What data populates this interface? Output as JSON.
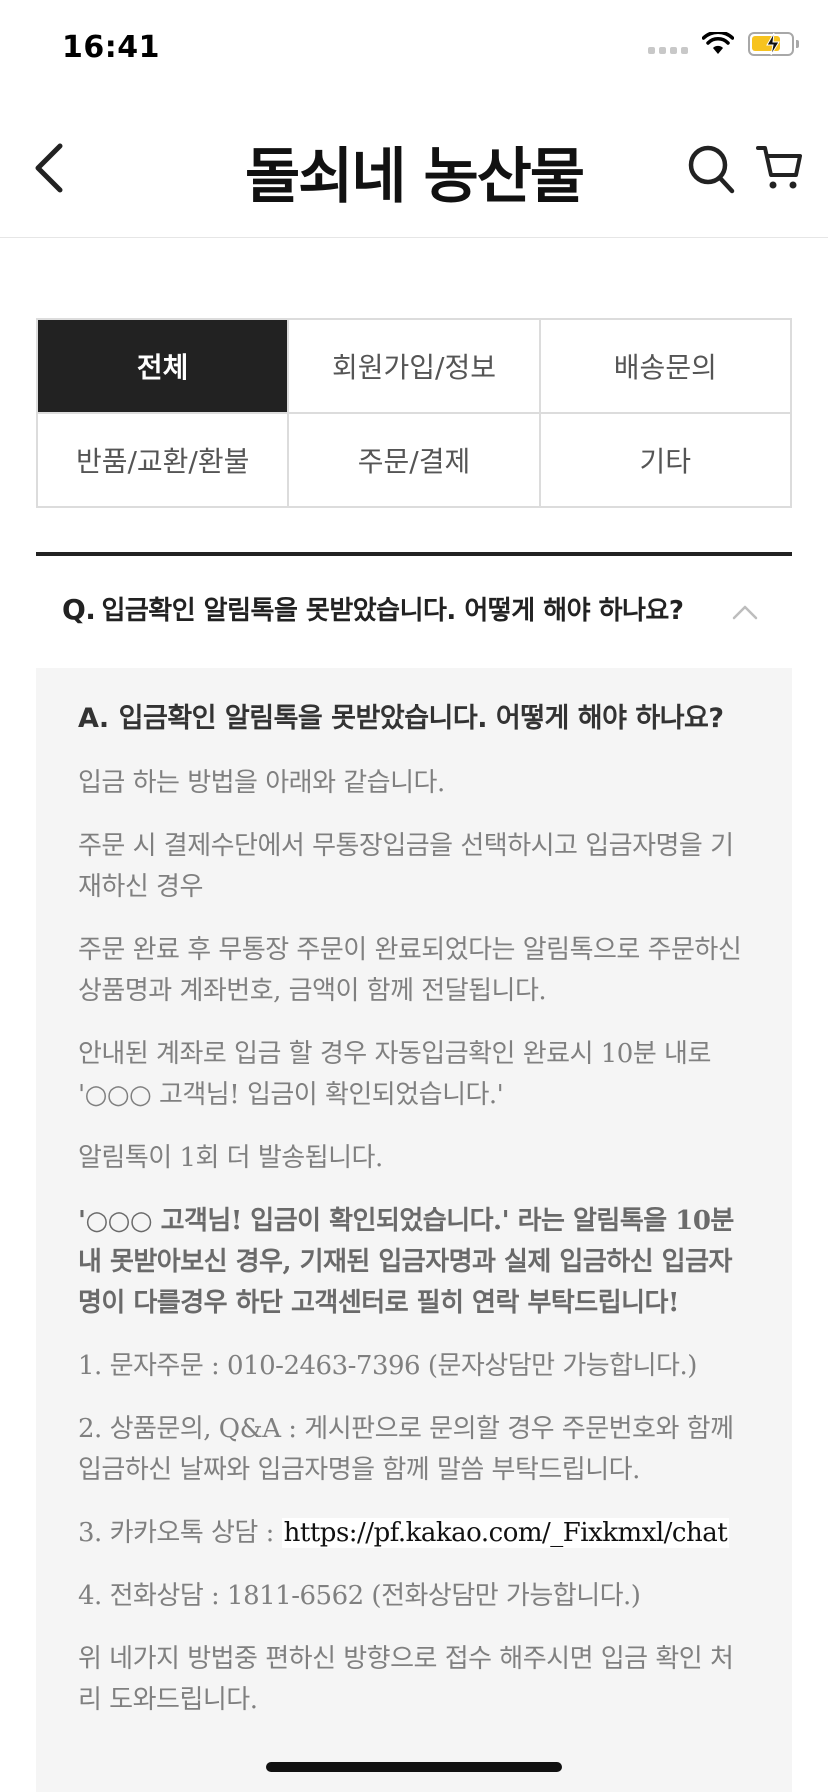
{
  "status_bar": {
    "time": "16:41"
  },
  "nav": {
    "title": "돌쇠네 농산물"
  },
  "categories": [
    {
      "label": "전체",
      "active": true
    },
    {
      "label": "회원가입/정보",
      "active": false
    },
    {
      "label": "배송문의",
      "active": false
    },
    {
      "label": "반품/교환/환불",
      "active": false
    },
    {
      "label": "주문/결제",
      "active": false
    },
    {
      "label": "기타",
      "active": false
    }
  ],
  "faq": {
    "question_prefix": "Q.",
    "question": "입금확인 알림톡을 못받았습니다. 어떻게 해야 하나요?",
    "answer_prefix": "A.",
    "answer_title": "입금확인 알림톡을 못받았습니다. 어떻게 해야 하나요?",
    "paragraphs": [
      "입금 하는 방법을 아래와 같습니다.",
      "주문 시 결제수단에서 무통장입금을 선택하시고 입금자명을 기재하신 경우",
      "주문 완료 후 무통장 주문이 완료되었다는 알림톡으로  주문하신 상품명과 계좌번호, 금액이 함께 전달됩니다.",
      "안내된 계좌로 입금 할 경우 자동입금확인 완료시 10분 내로 '○○○ 고객님! 입금이 확인되었습니다.'",
      "알림톡이 1회 더 발송됩니다.",
      " '○○○ 고객님! 입금이 확인되었습니다.' 라는 알림톡을 10분 내 못받아보신 경우, 기재된 입금자명과 실제 입금하신 입금자명이 다를경우 하단 고객센터로 필히 연락 부탁드립니다!",
      " 1. 문자주문 : 010-2463-7396 (문자상담만 가능합니다.)",
      "2. 상품문의, Q&A : 게시판으로 문의할 경우 주문번호와 함께 입금하신 날짜와 입금자명을 함께 말씀 부탁드립니다.",
      "3. 카카오톡 상담 : ",
      " 4. 전화상담 : 1811-6562 (전화상담만 가능합니다.)",
      "위 네가지 방법중 편하신 방향으로 접수 해주시면 입금 확인 처리 도와드립니다."
    ],
    "kakao_link": "https://pf.kakao.com/_Fixkmxl/chat"
  }
}
